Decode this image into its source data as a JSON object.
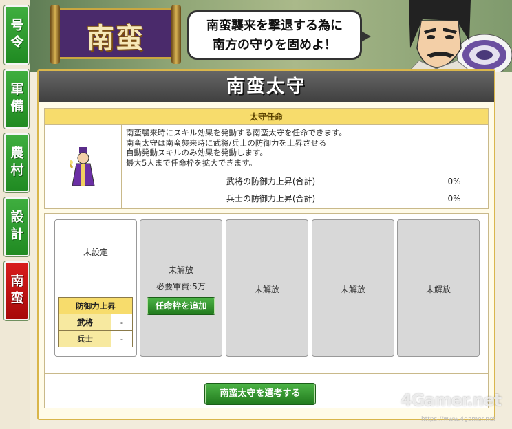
{
  "side_tabs": [
    {
      "label": "号令",
      "active": false
    },
    {
      "label": "軍備",
      "active": false
    },
    {
      "label": "農村",
      "active": false
    },
    {
      "label": "設計",
      "active": false
    },
    {
      "label": "南蛮",
      "active": true
    }
  ],
  "banner": {
    "scroll_title": "南蛮",
    "speech_line1": "南蛮襲来を撃退する為に",
    "speech_line2": "南方の守りを固めよ！"
  },
  "panel": {
    "title": "南蛮太守",
    "info": {
      "header": "太守任命",
      "desc": [
        "南蛮襲来時にスキル効果を発動する南蛮太守を任命できます。",
        "南蛮太守は南蛮襲来時に武将/兵士の防御力を上昇させる",
        "自動発動スキルのみ効果を発動します。",
        "最大5人まで任命枠を拡大できます。"
      ],
      "stats": [
        {
          "label": "武将の防御力上昇(合計)",
          "value": "0%"
        },
        {
          "label": "兵士の防御力上昇(合計)",
          "value": "0%"
        }
      ]
    },
    "slots": {
      "free": {
        "status": "未設定",
        "def_header": "防御力上昇",
        "rows": [
          {
            "key": "武将",
            "value": "-"
          },
          {
            "key": "兵士",
            "value": "-"
          }
        ]
      },
      "locked_first": {
        "status": "未解放",
        "cost": "必要軍費:5万",
        "button": "任命枠を追加"
      },
      "locked_others": [
        "未解放",
        "未解放",
        "未解放"
      ]
    },
    "appoint_button": "南蛮太守を選考する"
  },
  "watermark": {
    "text": "4Gamer.net",
    "url": "https://www.4gamer.net"
  }
}
